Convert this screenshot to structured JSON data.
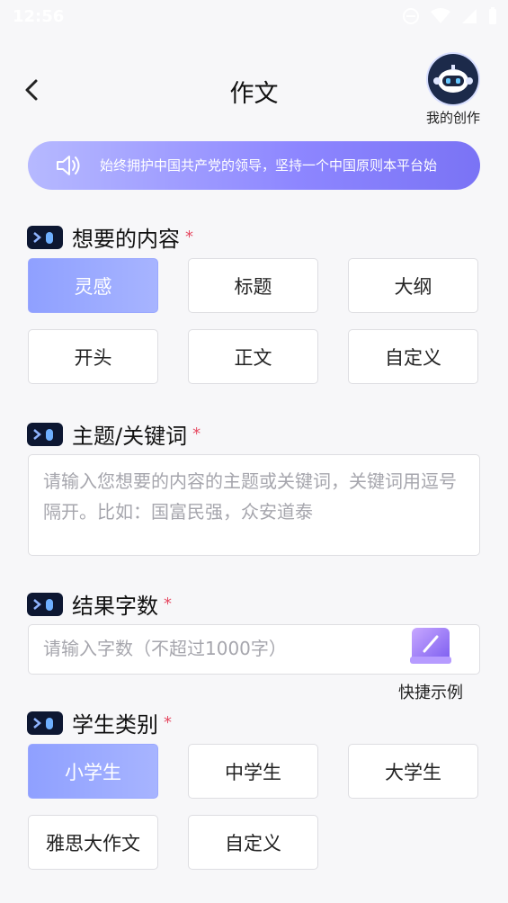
{
  "status_bar": {
    "time": "12:56"
  },
  "header": {
    "title": "作文",
    "my_creation_label": "我的创作"
  },
  "notice": {
    "text": "始终拥护中国共产党的领导，坚持一个中国原则本平台始"
  },
  "sections": {
    "content": {
      "label": "想要的内容",
      "required": "*",
      "options": [
        "灵感",
        "标题",
        "大纲",
        "开头",
        "正文",
        "自定义"
      ],
      "selected": "灵感"
    },
    "topic": {
      "label": "主题/关键词",
      "required": "*",
      "placeholder": "请输入您想要的内容的主题或关键词，关键词用逗号隔开。比如：国富民强，众安道泰"
    },
    "word_count": {
      "label": "结果字数",
      "required": "*",
      "placeholder": "请输入字数（不超过1000字）"
    },
    "student_type": {
      "label": "学生类别",
      "required": "*",
      "options": [
        "小学生",
        "中学生",
        "大学生",
        "雅思大作文",
        "自定义"
      ],
      "selected": "小学生"
    }
  },
  "quick_example": {
    "label": "快捷示例"
  },
  "colors": {
    "accent_gradient_start": "#8fa0ff",
    "accent_gradient_end": "#a7b4ff",
    "notice_gradient_start": "#b6b9ff",
    "notice_gradient_end": "#7a73f5",
    "required": "#e64b63"
  }
}
